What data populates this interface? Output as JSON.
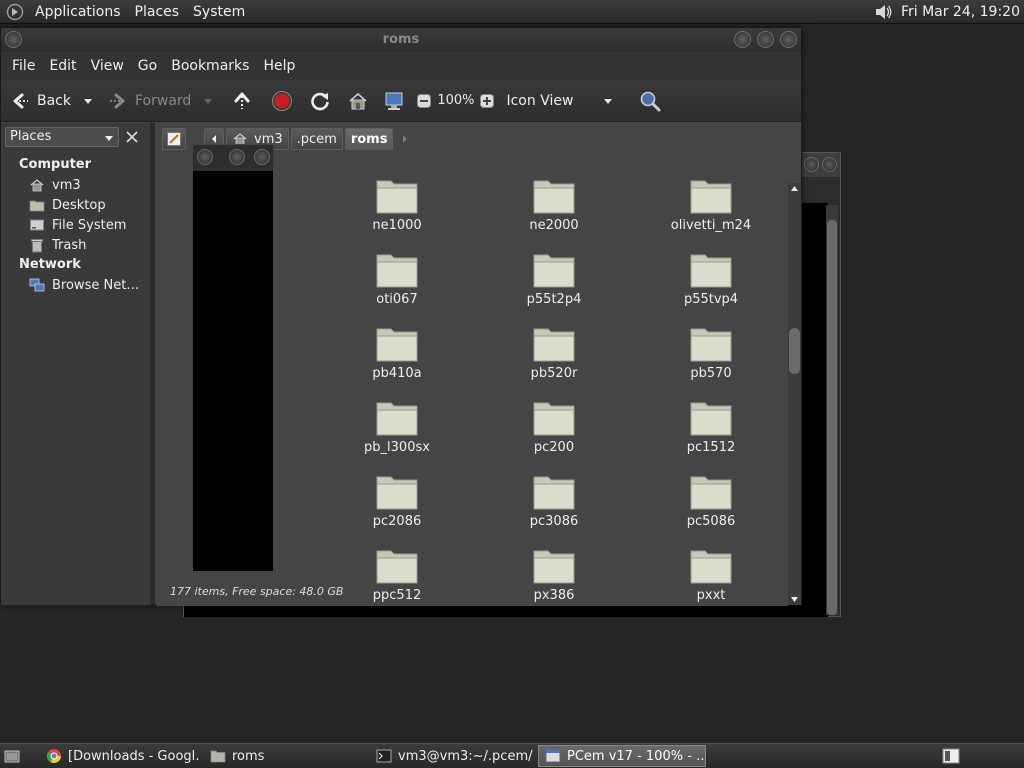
{
  "top_panel": {
    "menus": [
      "Applications",
      "Places",
      "System"
    ],
    "clock": "Fri Mar 24, 19:20"
  },
  "window": {
    "title": "roms",
    "menu": [
      "File",
      "Edit",
      "View",
      "Go",
      "Bookmarks",
      "Help"
    ]
  },
  "toolbar": {
    "back": "Back",
    "forward": "Forward",
    "zoom": "100%",
    "view_mode": "Icon View"
  },
  "sidebar": {
    "selector": "Places",
    "sections": [
      {
        "heading": "Computer",
        "items": [
          "vm3",
          "Desktop",
          "File System",
          "Trash"
        ]
      },
      {
        "heading": "Network",
        "items": [
          "Browse Net…"
        ]
      }
    ]
  },
  "location": {
    "crumbs": [
      "vm3",
      ".pcem",
      "roms"
    ]
  },
  "files": [
    "ne1000",
    "ne2000",
    "olivetti_m24",
    "oti067",
    "p55t2p4",
    "p55tvp4",
    "pb410a",
    "pb520r",
    "pb570",
    "pb_l300sx",
    "pc200",
    "pc1512",
    "pc2086",
    "pc3086",
    "pc5086",
    "ppc512",
    "px386",
    "pxxt"
  ],
  "status": "177 items, Free space: 48.0 GB",
  "taskbar": {
    "items": [
      "[Downloads - Googl…",
      "roms",
      "vm3@vm3:~/.pcem/…",
      "PCem v17 - 100% - …"
    ]
  }
}
